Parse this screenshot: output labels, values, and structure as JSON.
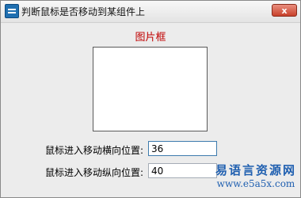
{
  "window": {
    "title": "判断鼠标是否移动到某组件上",
    "close_label": "x"
  },
  "main": {
    "picture_label": "图片框",
    "horizontal_label": "鼠标进入移动横向位置:",
    "horizontal_value": "36",
    "vertical_label": "鼠标进入移动纵向位置:",
    "vertical_value": "40"
  },
  "watermark": {
    "line1": "易语言资源网",
    "line2": "www.e5a5x.com"
  },
  "colors": {
    "picture_label": "#c00000",
    "close_button": "#c8412b",
    "watermark": "#1f5fb0"
  }
}
